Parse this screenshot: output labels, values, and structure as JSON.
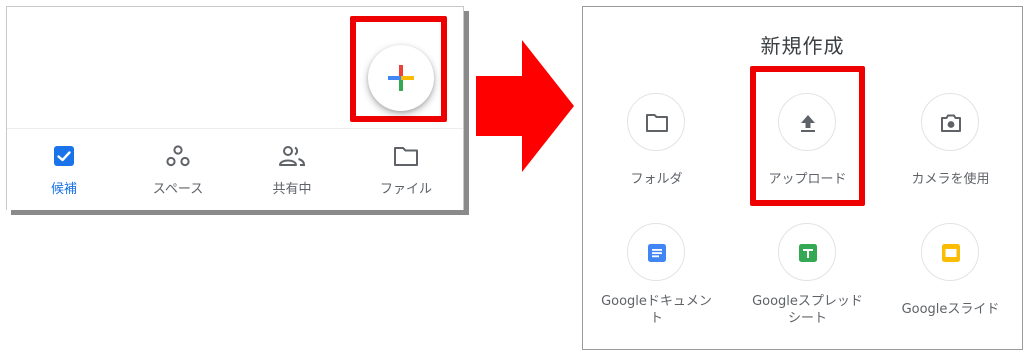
{
  "left": {
    "nav_items": [
      {
        "label": "候補",
        "icon": "check-square-icon",
        "active": true
      },
      {
        "label": "スペース",
        "icon": "spaces-icon",
        "active": false
      },
      {
        "label": "共有中",
        "icon": "people-icon",
        "active": false
      },
      {
        "label": "ファイル",
        "icon": "folder-icon",
        "active": false
      }
    ],
    "fab_icon": "plus-multicolor-icon"
  },
  "colors": {
    "accent": "#1a73e8",
    "highlight": "#ee0000",
    "arrow": "#ff0000",
    "google_blue": "#4285f4",
    "google_red": "#ea4335",
    "google_yellow": "#fbbc04",
    "google_green": "#34a853"
  },
  "sheet": {
    "title": "新規作成",
    "options": [
      {
        "label": "フォルダ",
        "icon": "folder-icon"
      },
      {
        "label": "アップロード",
        "icon": "upload-icon"
      },
      {
        "label": "カメラを使用",
        "icon": "camera-icon"
      },
      {
        "label": "Googleドキュメント",
        "icon": "google-docs-icon"
      },
      {
        "label": "Googleスプレッドシート",
        "icon": "google-sheets-icon"
      },
      {
        "label": "Googleスライド",
        "icon": "google-slides-icon"
      }
    ]
  }
}
